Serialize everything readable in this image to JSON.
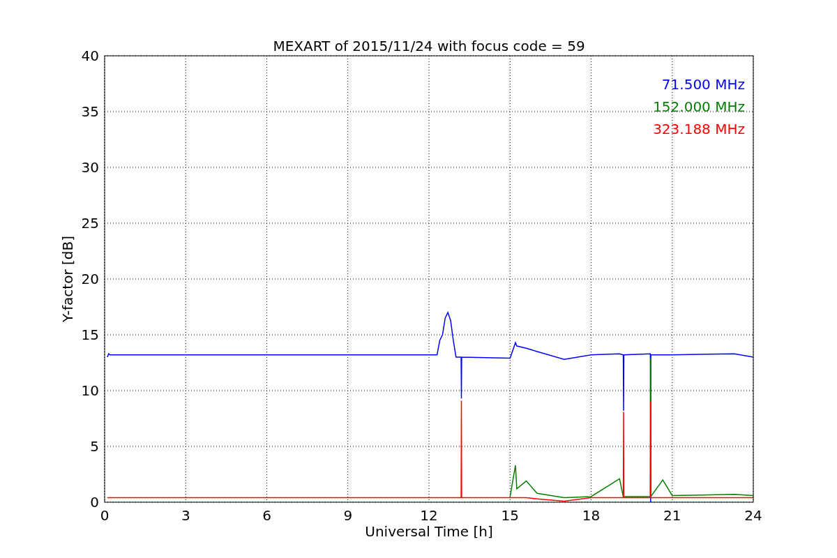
{
  "chart_data": {
    "type": "line",
    "title": "MEXART of 2015/11/24 with focus code = 59",
    "xlabel": "Universal Time [h]",
    "ylabel": "Y-factor [dB]",
    "x": [
      0.1,
      0.15,
      0.2,
      6,
      12.3,
      12.4,
      12.5,
      12.6,
      12.7,
      12.8,
      12.9,
      13.0,
      13.19,
      13.2,
      13.21,
      15,
      15.2,
      15.25,
      15.6,
      16,
      17,
      18,
      19.05,
      19.19,
      19.2,
      19.21,
      20.19,
      20.2,
      20.21,
      20.65,
      21,
      23.3,
      24
    ],
    "series": [
      {
        "name": "71.500 MHz",
        "color": "#0000ff",
        "values": [
          13.0,
          13.3,
          13.2,
          13.2,
          13.2,
          14.5,
          15,
          16.5,
          17,
          16.3,
          14.5,
          13.0,
          13.0,
          9.3,
          13.0,
          12.9,
          14.3,
          14.0,
          13.8,
          13.5,
          12.8,
          13.2,
          13.3,
          13.2,
          8.2,
          13.2,
          13.3,
          0,
          13.2,
          13.2,
          13.2,
          13.3,
          13.0
        ]
      },
      {
        "name": "152.000 MHz",
        "color": "#008000",
        "values": [
          null,
          null,
          null,
          null,
          null,
          null,
          null,
          null,
          null,
          null,
          null,
          null,
          null,
          null,
          null,
          0.5,
          3.3,
          1.2,
          1.9,
          0.8,
          0.4,
          0.5,
          2.1,
          0.5,
          0.5,
          0.5,
          0.5,
          12.9,
          0.5,
          2.0,
          0.6,
          0.7,
          0.6
        ]
      },
      {
        "name": "323.188 MHz",
        "color": "#ff0000",
        "values": [
          0.4,
          0.4,
          0.4,
          0.4,
          0.4,
          0.4,
          0.4,
          0.4,
          0.4,
          0.4,
          0.4,
          0.4,
          0.4,
          9.1,
          0.4,
          0.4,
          0.4,
          0.4,
          0.4,
          0.3,
          0.1,
          0.4,
          0.4,
          0.4,
          8.1,
          0.4,
          0.4,
          9.0,
          0.4,
          0.4,
          0.4,
          0.4,
          0.4
        ]
      }
    ],
    "grid": true,
    "xlim": [
      0,
      24
    ],
    "ylim": [
      0,
      40
    ],
    "xticks": [
      0,
      3,
      6,
      9,
      12,
      15,
      18,
      21,
      24
    ],
    "yticks": [
      0,
      5,
      10,
      15,
      20,
      25,
      30,
      35,
      40
    ]
  }
}
